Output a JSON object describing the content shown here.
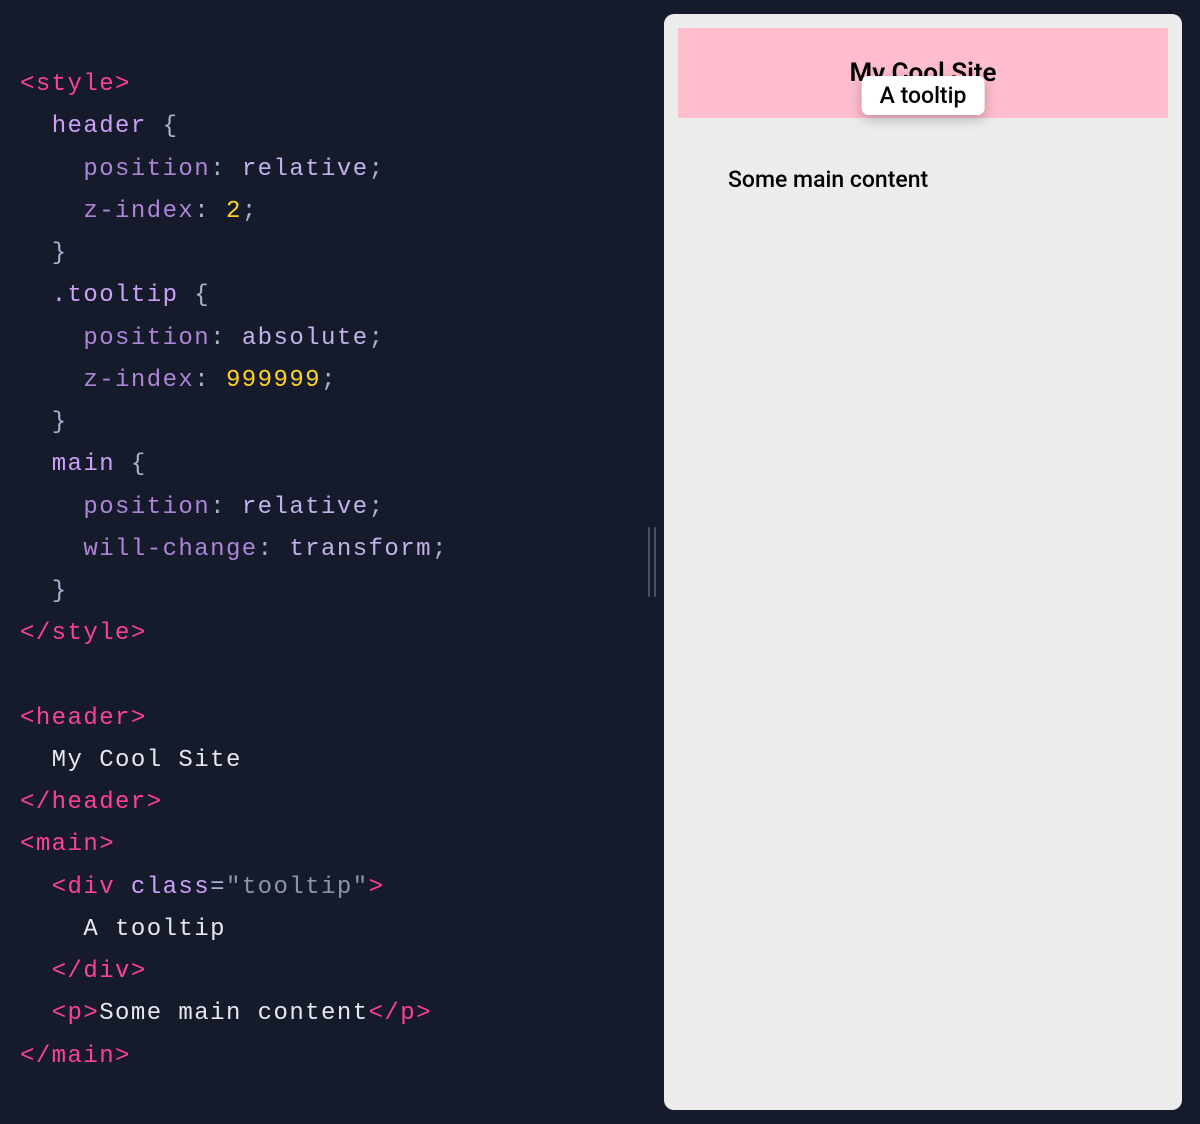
{
  "code": {
    "tags": {
      "style_open": "<style>",
      "style_close": "</style>",
      "header_open": "<header>",
      "header_close": "</header>",
      "main_open": "<main>",
      "main_close": "</main>",
      "div_open": "<div",
      "div_close": "</div>",
      "p_open": "<p>",
      "p_close": "</p>",
      "gt": ">"
    },
    "sel": {
      "header": "header",
      "tooltip": ".tooltip",
      "main": "main"
    },
    "open": " {",
    "close": "}",
    "prop": {
      "position": "position",
      "z_index": "z-index",
      "will_change": "will-change"
    },
    "sep": ": ",
    "semi": ";",
    "val": {
      "relative": "relative",
      "absolute": "absolute",
      "transform": "transform",
      "two": "2",
      "many9": "999999"
    },
    "attr": {
      "class_label": "class",
      "eq": "=",
      "q": "\"",
      "tooltip": "tooltip"
    },
    "text": {
      "header": "  My Cool Site",
      "tooltip": "    A tooltip",
      "para": "Some main content"
    }
  },
  "preview": {
    "header": "My Cool Site",
    "tooltip": "A tooltip",
    "paragraph": "Some main content"
  }
}
